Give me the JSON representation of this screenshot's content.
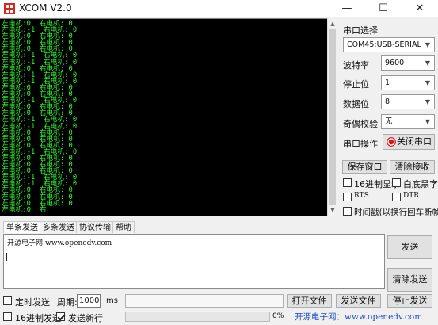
{
  "window": {
    "title": "XCOM V2.0",
    "controls": [
      "—",
      "☐",
      "✕"
    ]
  },
  "terminal": {
    "lines": [
      "左电机:0  右电机: 0",
      "左电机:-1  右电机: 0",
      "左电机:0  右电机: 0",
      "左电机:0  右电机: 0",
      "左电机:0  右电机: 0",
      "左电机:-1  右电机: 0",
      "左电机:-1  右电机: 0",
      "左电机:0  右电机: 0",
      "左电机:-1  右电机: 0",
      "左电机:-1  右电机: 0",
      "左电机:0  右电机: 0",
      "左电机:0  右电机: 0",
      "左电机:-1  右电机: 0",
      "左电机:0  右电机: 0",
      "左电机:0  右电机: 0",
      "左电机:-1  右电机: 0",
      "左电机:-1  右电机: 0",
      "左电机:0  右电机: 0",
      "左电机:0  右电机: 0",
      "左电机:0  右电机: 0",
      "左电机:-1  右电机: 0",
      "左电机:0  右电机: 0",
      "左电机:0  右电机: 0",
      "左电机:0  右电机: 0",
      "左电机:-1  右电机: 0",
      "左电机:-1  右电机: 0",
      "左电机:0  右电机: 0",
      "左电机:0  右电机: 0",
      "左电机:0  右电机: 0",
      "左电机:0  右"
    ]
  },
  "serial": {
    "port_label": "串口选择",
    "port_value": "COM45:USB-SERIAL",
    "baud_label": "波特率",
    "baud_value": "9600",
    "stop_label": "停止位",
    "stop_value": "1",
    "data_label": "数据位",
    "data_value": "8",
    "parity_label": "奇偶校验",
    "parity_value": "无",
    "op_label": "串口操作",
    "op_button": "关闭串口"
  },
  "receive": {
    "save_button": "保存窗口",
    "clear_button": "清除接收",
    "hex_display": "16进制显示",
    "white_bg": "白底黑字",
    "rts": "RTS",
    "dtr": "DTR",
    "timestamp": "时间戳(以换行回车断帧)"
  },
  "tabs": [
    "单条发送",
    "多条发送",
    "协议传输",
    "帮助"
  ],
  "send": {
    "text": "开源电子网:www.openedv.com",
    "send_button": "发送",
    "clear_button": "清除发送",
    "timed_send": "定时发送",
    "period_label": "周期:",
    "period_value": "1000",
    "period_unit": "ms",
    "open_file": "打开文件",
    "send_file": "发送文件",
    "stop_send": "停止发送",
    "hex_send": "16进制发送",
    "send_newline": "发送新行",
    "progress": "0%",
    "progress_value": 0,
    "website": "开源电子网：www.openedv.com"
  },
  "colors": {
    "terminal_bg": "#000000",
    "terminal_text": "#2eff2e",
    "website_text": "#1a4dbf",
    "close_port_indicator": "#e01010"
  },
  "icons": {
    "app": "xcom-logo-icon",
    "dropdown": "chevron-down-icon",
    "port_status": "red-indicator-icon"
  }
}
